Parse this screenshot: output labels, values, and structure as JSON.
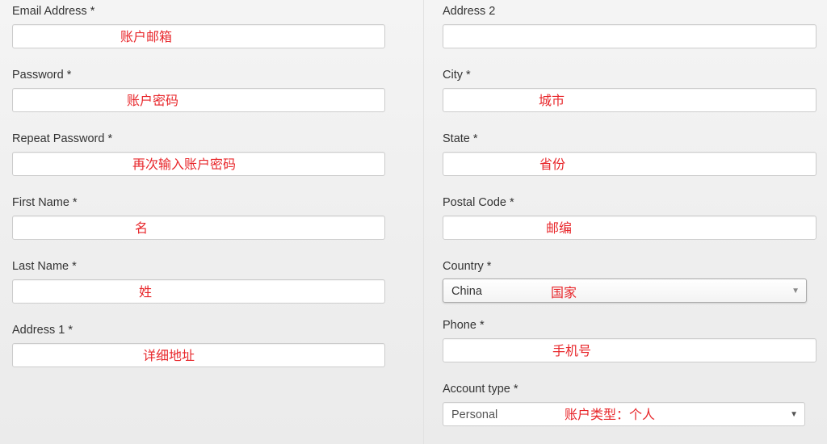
{
  "left_column": [
    {
      "key": "email",
      "label": "Email Address *",
      "annotation": "账户邮箱"
    },
    {
      "key": "password",
      "label": "Password *",
      "annotation": "账户密码"
    },
    {
      "key": "repeat_password",
      "label": "Repeat Password *",
      "annotation": "再次输入账户密码"
    },
    {
      "key": "first_name",
      "label": "First Name *",
      "annotation": "名"
    },
    {
      "key": "last_name",
      "label": "Last Name *",
      "annotation": "姓"
    },
    {
      "key": "address1",
      "label": "Address 1 *",
      "annotation": "详细地址"
    }
  ],
  "right_column": [
    {
      "key": "address2",
      "label": "Address 2",
      "annotation": ""
    },
    {
      "key": "city",
      "label": "City *",
      "annotation": "城市"
    },
    {
      "key": "state",
      "label": "State *",
      "annotation": "省份"
    },
    {
      "key": "postal_code",
      "label": "Postal Code *",
      "annotation": "邮编"
    },
    {
      "key": "country",
      "label": "Country *",
      "selected": "China",
      "annotation": "国家"
    },
    {
      "key": "phone",
      "label": "Phone *",
      "annotation": "手机号"
    },
    {
      "key": "account_type",
      "label": "Account type *",
      "selected": "Personal",
      "annotation": "账户类型：个人"
    }
  ],
  "icons": {
    "dropdown_arrow": "caret-down-icon"
  },
  "colors": {
    "annotation": "#e8272b",
    "border": "#cccccc",
    "background": "#f2f2f2"
  }
}
